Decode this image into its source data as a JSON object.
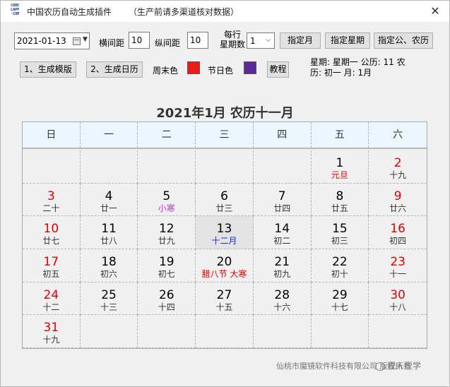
{
  "window": {
    "logo_lines": [
      "CORE",
      "LAPP",
      "·COM"
    ],
    "title": "中国农历自动生成插件",
    "title_note": "（生产前请多渠道核对数据）",
    "close_glyph": "✕"
  },
  "toolbar": {
    "date_value": "2021-01-13",
    "h_spacing_label": "横间距",
    "h_spacing_value": "10",
    "v_spacing_label": "纵间距",
    "v_spacing_value": "10",
    "per_row_label_1": "每行",
    "per_row_label_2": "星期数",
    "per_row_value": "1",
    "btn_month": "指定月",
    "btn_weekday": "指定星期",
    "btn_gregorian_lunar": "指定公、农历",
    "btn_gen_template": "1、生成模版",
    "btn_gen_calendar": "2、生成日历",
    "weekend_color_label": "周末色",
    "weekend_color": "#e81c1c",
    "holiday_color_label": "节日色",
    "holiday_color": "#5b2a96",
    "btn_tutorial": "教程"
  },
  "info": {
    "line1": "星期: 星期一    公历: 11    农",
    "line2": "历: 初一      月: 1月"
  },
  "calendar": {
    "title_solar": "2021年1月",
    "title_lunar": "农历十一月",
    "weekdays": [
      "日",
      "一",
      "二",
      "三",
      "四",
      "五",
      "六"
    ],
    "cells": [
      {
        "day": "",
        "lunar": "",
        "kind": "",
        "weekend": false,
        "today": false
      },
      {
        "day": "",
        "lunar": "",
        "kind": "",
        "weekend": false,
        "today": false
      },
      {
        "day": "",
        "lunar": "",
        "kind": "",
        "weekend": false,
        "today": false
      },
      {
        "day": "",
        "lunar": "",
        "kind": "",
        "weekend": false,
        "today": false
      },
      {
        "day": "",
        "lunar": "",
        "kind": "",
        "weekend": false,
        "today": false
      },
      {
        "day": "1",
        "lunar": "元旦",
        "kind": "festival",
        "weekend": false,
        "today": false
      },
      {
        "day": "2",
        "lunar": "十九",
        "kind": "",
        "weekend": true,
        "today": false
      },
      {
        "day": "3",
        "lunar": "二十",
        "kind": "",
        "weekend": true,
        "today": false
      },
      {
        "day": "4",
        "lunar": "廿一",
        "kind": "",
        "weekend": false,
        "today": false
      },
      {
        "day": "5",
        "lunar": "小寒",
        "kind": "term",
        "weekend": false,
        "today": false
      },
      {
        "day": "6",
        "lunar": "廿三",
        "kind": "",
        "weekend": false,
        "today": false
      },
      {
        "day": "7",
        "lunar": "廿四",
        "kind": "",
        "weekend": false,
        "today": false
      },
      {
        "day": "8",
        "lunar": "廿五",
        "kind": "",
        "weekend": false,
        "today": false
      },
      {
        "day": "9",
        "lunar": "廿六",
        "kind": "",
        "weekend": true,
        "today": false
      },
      {
        "day": "10",
        "lunar": "廿七",
        "kind": "",
        "weekend": true,
        "today": false
      },
      {
        "day": "11",
        "lunar": "廿八",
        "kind": "",
        "weekend": false,
        "today": false
      },
      {
        "day": "12",
        "lunar": "廿九",
        "kind": "",
        "weekend": false,
        "today": false
      },
      {
        "day": "13",
        "lunar": "十二月",
        "kind": "month",
        "weekend": false,
        "today": true
      },
      {
        "day": "14",
        "lunar": "初二",
        "kind": "",
        "weekend": false,
        "today": false
      },
      {
        "day": "15",
        "lunar": "初三",
        "kind": "",
        "weekend": false,
        "today": false
      },
      {
        "day": "16",
        "lunar": "初四",
        "kind": "",
        "weekend": true,
        "today": false
      },
      {
        "day": "17",
        "lunar": "初五",
        "kind": "",
        "weekend": true,
        "today": false
      },
      {
        "day": "18",
        "lunar": "初六",
        "kind": "",
        "weekend": false,
        "today": false
      },
      {
        "day": "19",
        "lunar": "初七",
        "kind": "",
        "weekend": false,
        "today": false
      },
      {
        "day": "20",
        "lunar": "腊八节 大寒",
        "kind": "festival",
        "weekend": false,
        "today": false
      },
      {
        "day": "21",
        "lunar": "初九",
        "kind": "",
        "weekend": false,
        "today": false
      },
      {
        "day": "22",
        "lunar": "初十",
        "kind": "",
        "weekend": false,
        "today": false
      },
      {
        "day": "23",
        "lunar": "十一",
        "kind": "",
        "weekend": true,
        "today": false
      },
      {
        "day": "24",
        "lunar": "十二",
        "kind": "",
        "weekend": true,
        "today": false
      },
      {
        "day": "25",
        "lunar": "十三",
        "kind": "",
        "weekend": false,
        "today": false
      },
      {
        "day": "26",
        "lunar": "十四",
        "kind": "",
        "weekend": false,
        "today": false
      },
      {
        "day": "27",
        "lunar": "十五",
        "kind": "",
        "weekend": false,
        "today": false
      },
      {
        "day": "28",
        "lunar": "十六",
        "kind": "",
        "weekend": false,
        "today": false
      },
      {
        "day": "29",
        "lunar": "十七",
        "kind": "",
        "weekend": false,
        "today": false
      },
      {
        "day": "30",
        "lunar": "十八",
        "kind": "",
        "weekend": true,
        "today": false
      },
      {
        "day": "31",
        "lunar": "十九",
        "kind": "",
        "weekend": true,
        "today": false
      },
      {
        "day": "",
        "lunar": "",
        "kind": "",
        "weekend": false,
        "today": false
      },
      {
        "day": "",
        "lunar": "",
        "kind": "",
        "weekend": false,
        "today": false
      },
      {
        "day": "",
        "lunar": "",
        "kind": "",
        "weekend": false,
        "today": false
      },
      {
        "day": "",
        "lunar": "",
        "kind": "",
        "weekend": false,
        "today": false
      },
      {
        "day": "",
        "lunar": "",
        "kind": "",
        "weekend": false,
        "today": false
      },
      {
        "day": "",
        "lunar": "",
        "kind": "",
        "weekend": false,
        "today": false
      }
    ]
  },
  "footer": {
    "company": "仙桃市魔镜软件科技有限公司 版权所有",
    "brand": "壹人壹学"
  }
}
